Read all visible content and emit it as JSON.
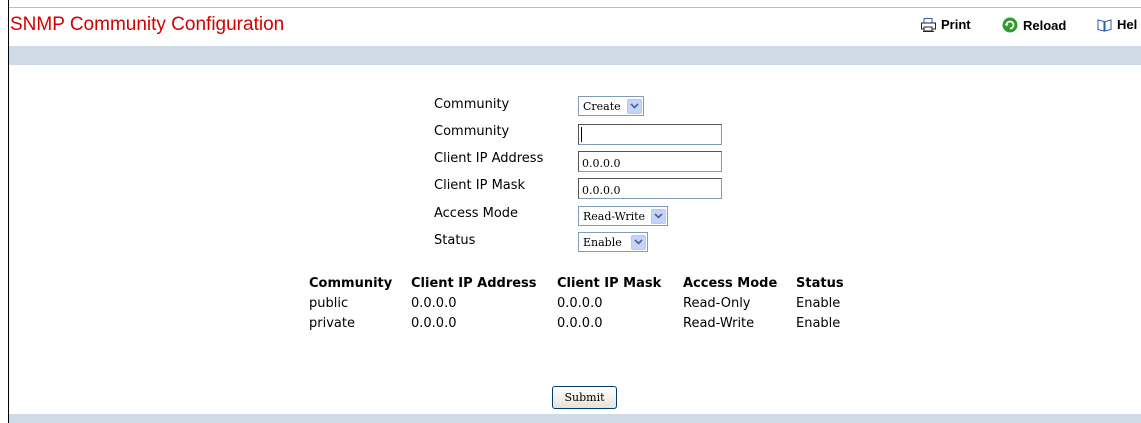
{
  "page": {
    "title": "SNMP Community Configuration"
  },
  "toolbar": {
    "print_label": "Print",
    "reload_label": "Reload",
    "help_label": "Hel"
  },
  "form": {
    "community_select_label": "Community",
    "community_select_value": "Create",
    "community_name_label": "Community",
    "community_name_value": "",
    "client_ip_label": "Client IP Address",
    "client_ip_value": "0.0.0.0",
    "client_mask_label": "Client IP Mask",
    "client_mask_value": "0.0.0.0",
    "access_mode_label": "Access Mode",
    "access_mode_value": "Read-Write",
    "status_label": "Status",
    "status_value": "Enable",
    "submit_label": "Submit"
  },
  "table": {
    "headers": [
      "Community",
      "Client IP Address",
      "Client IP Mask",
      "Access Mode",
      "Status"
    ],
    "rows": [
      [
        "public",
        "0.0.0.0",
        "0.0.0.0",
        "Read-Only",
        "Enable"
      ],
      [
        "private",
        "0.0.0.0",
        "0.0.0.0",
        "Read-Write",
        "Enable"
      ]
    ]
  },
  "colors": {
    "title": "#d40000",
    "band": "#cedbe6",
    "print_icon": "#2a5db0",
    "reload_icon": "#2e9d2e",
    "help_icon": "#2a5db0"
  },
  "icons": {
    "print": "printer-icon",
    "reload": "refresh-icon",
    "help": "book-icon",
    "dropdown": "chevron-down-icon"
  }
}
